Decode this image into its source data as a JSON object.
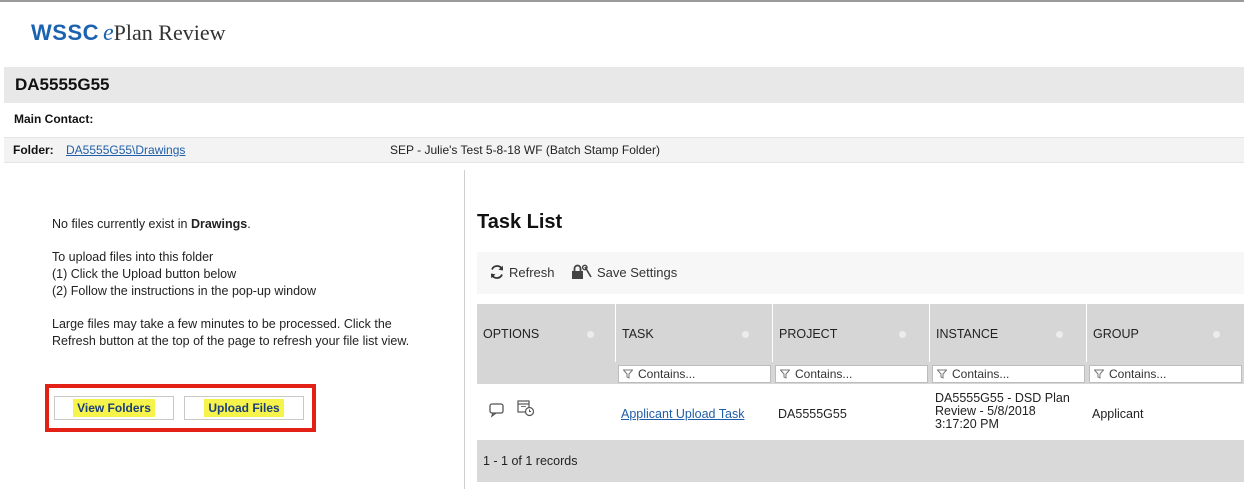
{
  "header": {
    "logo_brand": "WSSC",
    "logo_e": "e",
    "logo_rest": "Plan Review"
  },
  "project": {
    "title": "DA5555G55"
  },
  "main_contact": {
    "label": "Main Contact:"
  },
  "folder": {
    "label": "Folder:",
    "link": "DA5555G55\\Drawings",
    "description": "SEP - Julie's Test 5-8-18 WF (Batch Stamp Folder)"
  },
  "files_panel": {
    "msg_prefix": "No files currently exist in ",
    "msg_folder": "Drawings",
    "msg_suffix": ".",
    "upload_heading": "To upload files into this folder",
    "step1": "(1) Click the Upload button below",
    "step2": "(2) Follow the instructions in the pop-up window",
    "large_files_note": "Large files may take a few minutes to be processed. Click the Refresh button at the top of the page to refresh your file list view.",
    "view_folders_label": "View Folders",
    "upload_files_label": "Upload Files"
  },
  "task_list": {
    "title": "Task List",
    "refresh_label": "Refresh",
    "save_settings_label": "Save Settings",
    "columns": [
      "OPTIONS",
      "TASK",
      "PROJECT",
      "INSTANCE",
      "GROUP"
    ],
    "filter_placeholder": "Contains...",
    "rows": [
      {
        "task": "Applicant Upload Task",
        "project": "DA5555G55",
        "instance_line1": "DA5555G55 - DSD Plan",
        "instance_line2": "Review - 5/8/2018",
        "instance_line3": "3:17:20 PM",
        "group": "Applicant"
      }
    ],
    "records_label": "1 - 1 of 1 records"
  },
  "colors": {
    "brand_blue": "#1b63b0",
    "highlight_yellow": "#f6f34b",
    "annotation_red": "#e32016",
    "link_blue": "#1f5ea8"
  }
}
